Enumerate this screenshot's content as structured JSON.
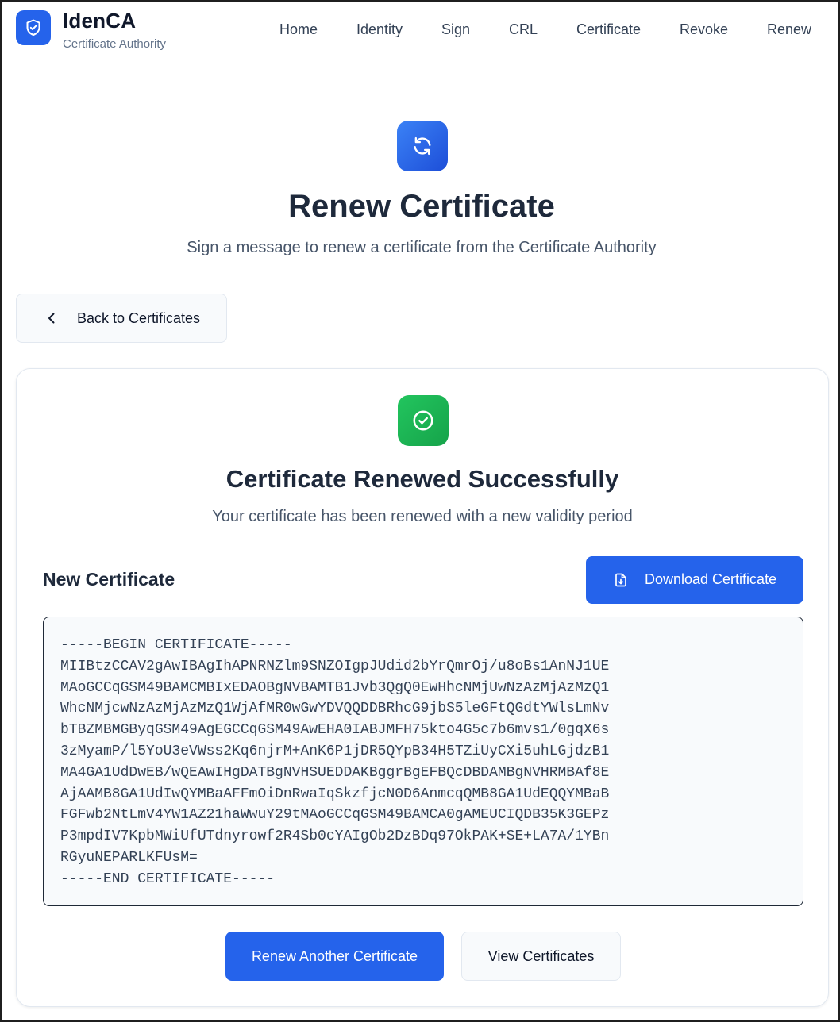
{
  "header": {
    "brand_name": "IdenCA",
    "brand_sub": "Certificate Authority",
    "logo_icon": "shield-check-icon",
    "nav": [
      "Home",
      "Identity",
      "Sign",
      "CRL",
      "Certificate",
      "Revoke",
      "Renew"
    ]
  },
  "hero": {
    "icon": "refresh-icon",
    "title": "Renew Certificate",
    "subtitle": "Sign a message to renew a certificate from the Certificate Authority"
  },
  "back_button": {
    "icon": "chevron-left-icon",
    "label": "Back to Certificates"
  },
  "result": {
    "icon": "check-circle-icon",
    "title": "Certificate Renewed Successfully",
    "subtitle": "Your certificate has been renewed with a new validity period",
    "cert_heading": "New Certificate",
    "download_icon": "file-download-icon",
    "download_label": "Download Certificate",
    "pem_lines": [
      "-----BEGIN CERTIFICATE-----",
      "MIIBtzCCAV2gAwIBAgIhAPNRNZlm9SNZOIgpJUdid2bYrQmrOj/u8oBs1AnNJ1UE",
      "MAoGCCqGSM49BAMCMBIxEDAOBgNVBAMTB1Jvb3QgQ0EwHhcNMjUwNzAzMjAzMzQ1",
      "WhcNMjcwNzAzMjAzMzQ1WjAfMR0wGwYDVQQDDBRhcG9jbS5leGFtQGdtYWlsLmNv",
      "bTBZMBMGByqGSM49AgEGCCqGSM49AwEHA0IABJMFH75kto4G5c7b6mvs1/0gqX6s",
      "3zMyamP/l5YoU3eVWss2Kq6njrM+AnK6P1jDR5QYpB34H5TZiUyCXi5uhLGjdzB1",
      "MA4GA1UdDwEB/wQEAwIHgDATBgNVHSUEDDAKBggrBgEFBQcDBDAMBgNVHRMBAf8E",
      "AjAAMB8GA1UdIwQYMBaAFFmOiDnRwaIqSkzfjcN0D6AnmcqQMB8GA1UdEQQYMBaB",
      "FGFwb2NtLmV4YW1AZ21haWwuY29tMAoGCCqGSM49BAMCA0gAMEUCIQDB35K3GEPz",
      "P3mpdIV7KpbMWiUfUTdnyrowf2R4Sb0cYAIgOb2DzBDq97OkPAK+SE+LA7A/1YBn",
      "RGyuNEPARLKFUsM=",
      "-----END CERTIFICATE-----"
    ],
    "renew_another_label": "Renew Another Certificate",
    "view_certificates_label": "View Certificates"
  },
  "colors": {
    "primary": "#2563eb",
    "success": "#16a34a",
    "text_dark": "#1e293b",
    "text_muted": "#475569"
  }
}
